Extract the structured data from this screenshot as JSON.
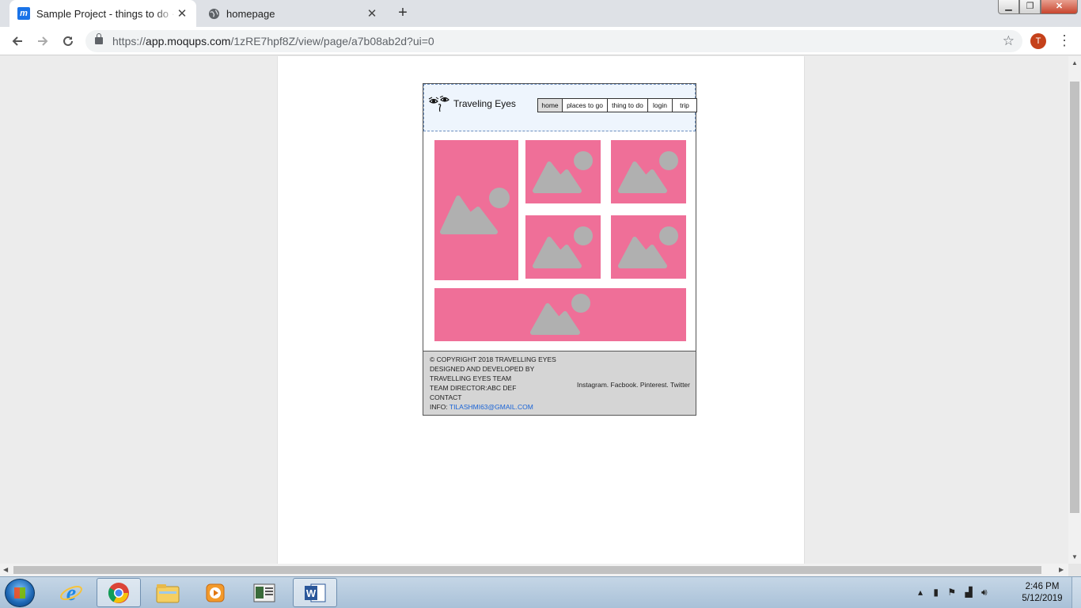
{
  "browser": {
    "tabs": [
      {
        "title": "Sample Project - things to do · Moqups",
        "favicon": "moqups-m-icon",
        "favicon_char": "m",
        "close": "✕"
      },
      {
        "title": "homepage",
        "favicon": "globe-icon",
        "favicon_char": "🌐",
        "close": "✕"
      }
    ],
    "new_tab": "+",
    "url_host": "app.moqups.com",
    "url_prefix": "https://",
    "url_path": "/1zRE7hpf8Z/view/page/a7b08ab2d?ui=0",
    "avatar_initial": "T",
    "window_controls": {
      "minimize": "▁",
      "maximize": "❐",
      "close": "✕"
    }
  },
  "mockup": {
    "brand": "Traveling Eyes",
    "nav": [
      "home",
      "places to go",
      "thing to do",
      "login",
      "trip"
    ],
    "selected_nav": "home",
    "accent_color": "#ef6f98",
    "placeholder_color": "#b0b0b0",
    "footer": {
      "lines": [
        "© COPYRIGHT 2018 TRAVELLING EYES",
        "DESIGNED AND DEVELOPED BY",
        "TRAVELLING EYES TEAM",
        "TEAM DIRECTOR:ABC DEF",
        "CONTACT"
      ],
      "info_label": "INFO: ",
      "info_email": "TILASHMI63@GMAIL.COM",
      "social": "Instagram. Facbook. Pinterest. Twitter"
    }
  },
  "taskbar": {
    "apps": [
      "internet-explorer-icon",
      "chrome-icon",
      "file-explorer-icon",
      "media-player-icon",
      "presentation-icon",
      "word-icon"
    ],
    "time": "2:46 PM",
    "date": "5/12/2019"
  }
}
